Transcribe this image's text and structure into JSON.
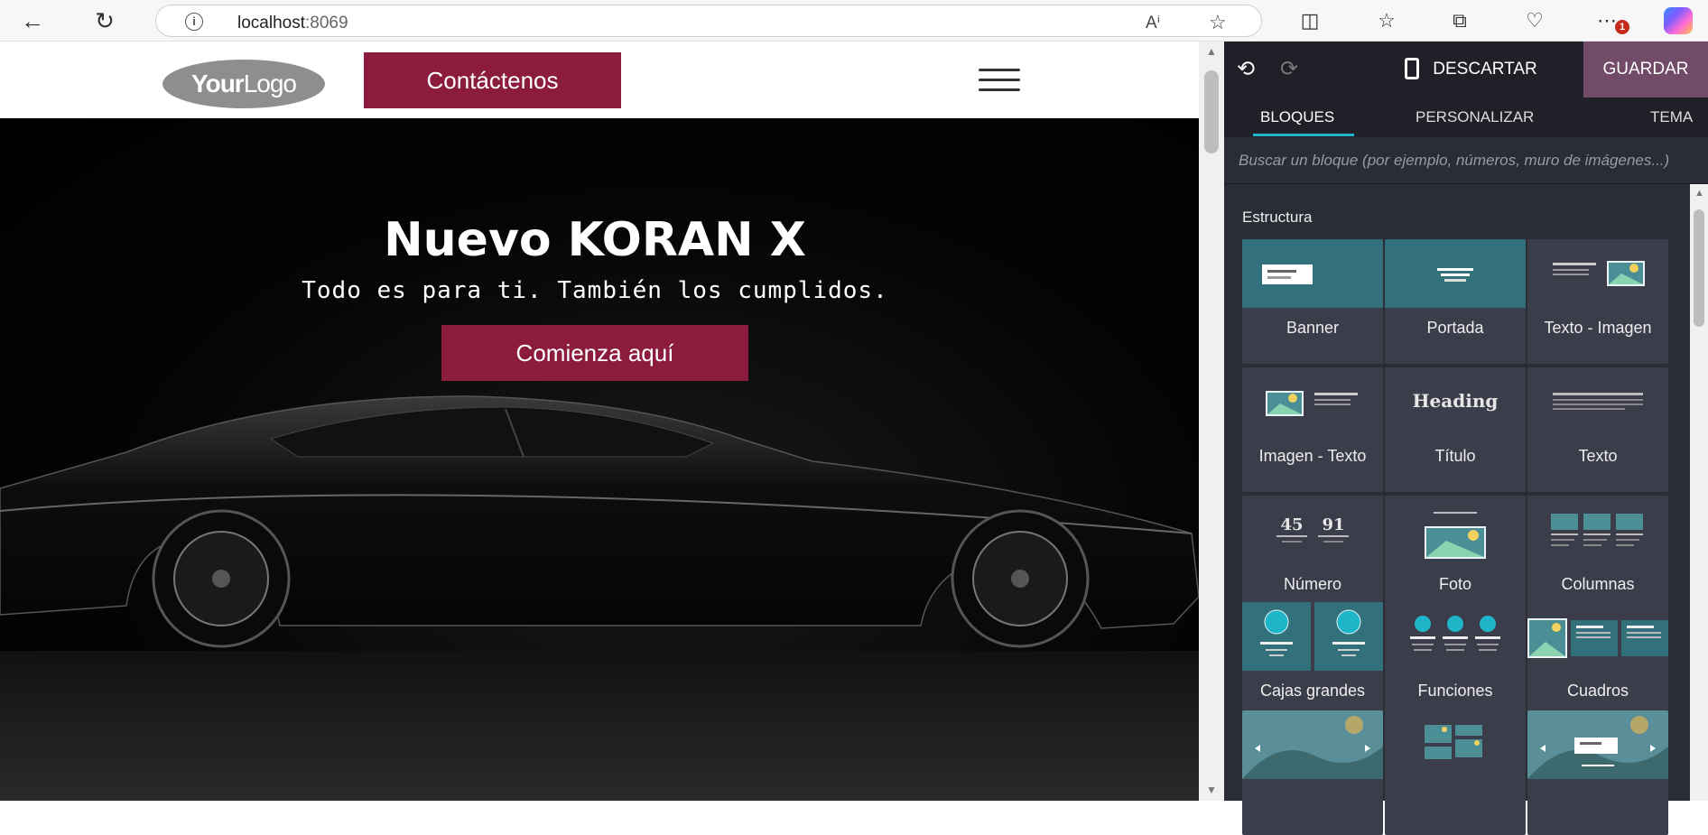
{
  "browser": {
    "url_host": "localhost",
    "url_port": ":8069",
    "badge_count": "1"
  },
  "site": {
    "logo_bold": "Your",
    "logo_light": "Logo",
    "contact_button": "Contáctenos",
    "hero": {
      "title": "Nuevo KORAN X",
      "subtitle": "Todo es para ti. También los cumplidos.",
      "cta": "Comienza aquí"
    }
  },
  "editor": {
    "discard": "DESCARTAR",
    "save": "GUARDAR",
    "tabs": [
      "BLOQUES",
      "PERSONALIZAR",
      "TEMA"
    ],
    "active_tab": "BLOQUES",
    "search_placeholder": "Buscar un bloque (por ejemplo, números, muro de imágenes...)",
    "section": "Estructura",
    "blocks": [
      {
        "label": "Banner",
        "icon": "banner-icon"
      },
      {
        "label": "Portada",
        "icon": "cover-icon"
      },
      {
        "label": "Texto - Imagen",
        "icon": "text-image-icon"
      },
      {
        "label": "Imagen - Texto",
        "icon": "image-text-icon"
      },
      {
        "label": "Título",
        "icon": "heading-icon",
        "icon_text": "Heading"
      },
      {
        "label": "Texto",
        "icon": "text-icon"
      },
      {
        "label": "Número",
        "icon": "numbers-icon",
        "numbers": [
          "45",
          "91"
        ]
      },
      {
        "label": "Foto",
        "icon": "picture-icon"
      },
      {
        "label": "Columnas",
        "icon": "columns-icon"
      },
      {
        "label": "Cajas grandes",
        "icon": "big-boxes-icon"
      },
      {
        "label": "Funciones",
        "icon": "features-icon"
      },
      {
        "label": "Cuadros",
        "icon": "masonry-icon"
      },
      {
        "label": "",
        "icon": "carousel-icon"
      },
      {
        "label": "",
        "icon": "image-wall-icon"
      },
      {
        "label": "",
        "icon": "slider-icon"
      }
    ],
    "accent_color": "#1eb5c8",
    "save_color": "#714b67"
  },
  "colors": {
    "brand": "#8b1c3e",
    "panel_bg": "#2a2c36",
    "tile_teal": "#32707b"
  }
}
